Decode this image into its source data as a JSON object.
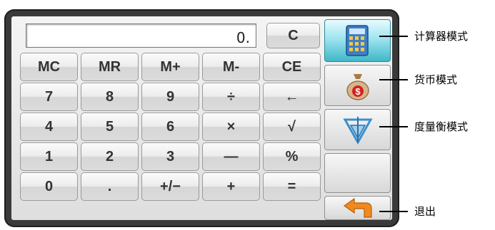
{
  "display": {
    "value": "0."
  },
  "clear_label": "C",
  "keypad": [
    [
      "MC",
      "MR",
      "M+",
      "M-",
      "CE"
    ],
    [
      "7",
      "8",
      "9",
      "÷",
      "←"
    ],
    [
      "4",
      "5",
      "6",
      "×",
      "√"
    ],
    [
      "1",
      "2",
      "3",
      "—",
      "%"
    ],
    [
      "0",
      ".",
      "+/−",
      "+",
      "="
    ]
  ],
  "side_buttons": [
    {
      "icon": "calculator-icon",
      "active": true
    },
    {
      "icon": "money-bag-icon"
    },
    {
      "icon": "measure-compass-icon"
    },
    {
      "icon": ""
    },
    {
      "icon": "exit-arrow-icon"
    }
  ],
  "annotations": {
    "calculator_mode": "计算器模式",
    "currency_mode": "货币模式",
    "measure_mode": "度量衡模式",
    "exit": "退出"
  },
  "colors": {
    "active_mode": "#3fb8c8",
    "exit_arrow": "#f08a1c",
    "money_sign": "#d32020"
  }
}
